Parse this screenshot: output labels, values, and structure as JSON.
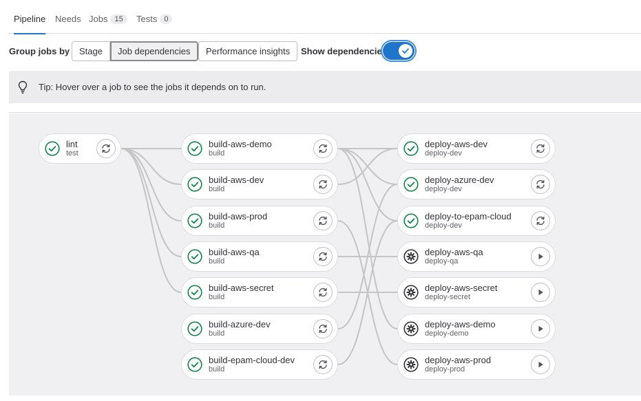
{
  "tabs": [
    {
      "label": "Pipeline"
    },
    {
      "label": "Needs"
    },
    {
      "label": "Jobs",
      "count": "15"
    },
    {
      "label": "Tests",
      "count": "0"
    }
  ],
  "controls": {
    "group_label": "Group jobs by",
    "stage_label": "Stage",
    "job_deps_label": "Job dependencies",
    "perf_label": "Performance insights",
    "show_deps_label": "Show dependencies",
    "show_deps_enabled": true
  },
  "tip": {
    "text": "Tip: Hover over a job to see the jobs it depends on to run."
  },
  "colors": {
    "success": "#108548",
    "manual": "#333238",
    "accent": "#1f75cb"
  },
  "jobs": [
    {
      "name": "lint",
      "stage": "test",
      "status": "success",
      "action": "retry-icon"
    },
    {
      "name": "build-aws-demo",
      "stage": "build",
      "status": "success",
      "action": "retry-icon"
    },
    {
      "name": "build-aws-dev",
      "stage": "build",
      "status": "success",
      "action": "retry-icon"
    },
    {
      "name": "build-aws-prod",
      "stage": "build",
      "status": "success",
      "action": "retry-icon"
    },
    {
      "name": "build-aws-qa",
      "stage": "build",
      "status": "success",
      "action": "retry-icon"
    },
    {
      "name": "build-aws-secret",
      "stage": "build",
      "status": "success",
      "action": "retry-icon"
    },
    {
      "name": "build-azure-dev",
      "stage": "build",
      "status": "success",
      "action": "retry-icon"
    },
    {
      "name": "build-epam-cloud-dev",
      "stage": "build",
      "status": "success",
      "action": "retry-icon"
    },
    {
      "name": "deploy-aws-dev",
      "stage": "deploy-dev",
      "status": "success",
      "action": "retry-icon"
    },
    {
      "name": "deploy-azure-dev",
      "stage": "deploy-dev",
      "status": "success",
      "action": "retry-icon"
    },
    {
      "name": "deploy-to-epam-cloud",
      "stage": "deploy-dev",
      "status": "success",
      "action": "retry-icon"
    },
    {
      "name": "deploy-aws-qa",
      "stage": "deploy-qa",
      "status": "manual",
      "action": "play-icon"
    },
    {
      "name": "deploy-aws-secret",
      "stage": "deploy-secret",
      "status": "manual",
      "action": "play-icon"
    },
    {
      "name": "deploy-aws-demo",
      "stage": "deploy-demo",
      "status": "manual",
      "action": "play-icon"
    },
    {
      "name": "deploy-aws-prod",
      "stage": "deploy-prod",
      "status": "manual",
      "action": "play-icon"
    }
  ],
  "needs": [
    [
      "lint",
      "build-aws-demo"
    ],
    [
      "lint",
      "build-aws-dev"
    ],
    [
      "lint",
      "build-aws-prod"
    ],
    [
      "lint",
      "build-aws-qa"
    ],
    [
      "lint",
      "build-aws-secret"
    ],
    [
      "build-aws-demo",
      "deploy-aws-dev"
    ],
    [
      "build-aws-demo",
      "deploy-azure-dev"
    ],
    [
      "build-aws-demo",
      "deploy-to-epam-cloud"
    ],
    [
      "build-aws-demo",
      "deploy-aws-demo"
    ],
    [
      "build-aws-dev",
      "deploy-aws-dev"
    ],
    [
      "build-aws-prod",
      "deploy-aws-prod"
    ],
    [
      "build-aws-qa",
      "deploy-aws-qa"
    ],
    [
      "build-aws-secret",
      "deploy-aws-secret"
    ],
    [
      "build-azure-dev",
      "deploy-azure-dev"
    ],
    [
      "build-epam-cloud-dev",
      "deploy-to-epam-cloud"
    ]
  ]
}
